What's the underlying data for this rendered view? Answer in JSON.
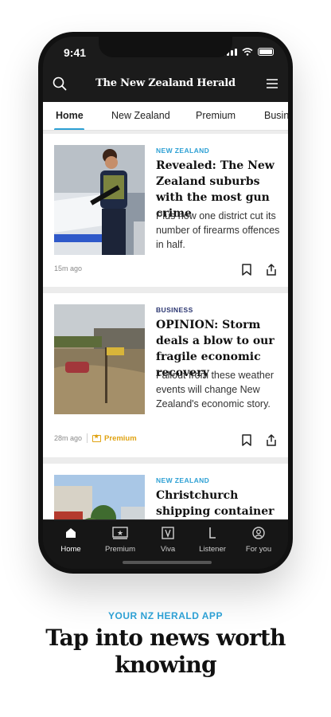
{
  "status": {
    "time": "9:41"
  },
  "app": {
    "masthead": "The New Zealand Herald"
  },
  "tabs": [
    {
      "label": "Home"
    },
    {
      "label": "New Zealand"
    },
    {
      "label": "Premium"
    },
    {
      "label": "Busin"
    }
  ],
  "articles": [
    {
      "section": "NEW ZEALAND",
      "headline": "Revealed: The New Zealand suburbs with the most gun crime",
      "summary": "Plus how one district cut its number of firearms offences in half.",
      "time": "15m ago"
    },
    {
      "section": "BUSINESS",
      "headline": "OPINION: Storm deals a blow to our fragile economic recovery",
      "summary": "Fallout from these weather events will change New Zealand's economic story.",
      "time": "28m ago",
      "badge": "Premium"
    },
    {
      "section": "NEW ZEALAND",
      "headline": "Christchurch shipping container site sparks more"
    }
  ],
  "nav": [
    {
      "label": "Home",
      "icon": "home-icon"
    },
    {
      "label": "Premium",
      "icon": "premium-icon"
    },
    {
      "label": "Viva",
      "icon": "viva-icon"
    },
    {
      "label": "Listener",
      "icon": "listener-icon"
    },
    {
      "label": "For you",
      "icon": "user-icon"
    }
  ],
  "promo": {
    "tagline": "YOUR NZ HERALD APP",
    "title": "Tap into news worth knowing"
  },
  "colors": {
    "accent": "#2da0d4",
    "premium": "#e0a313",
    "business": "#2a3570"
  }
}
